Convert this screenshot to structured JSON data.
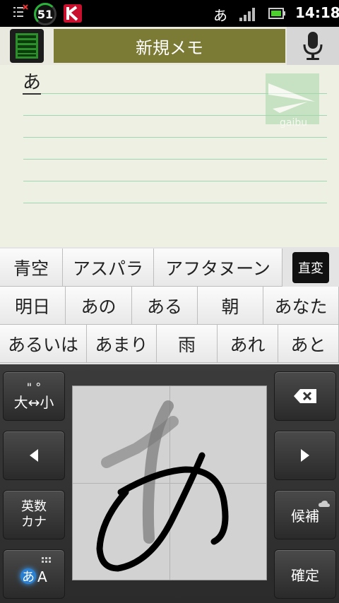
{
  "status_bar": {
    "badge_number": "51",
    "ime_indicator": "あ",
    "time": "14:18"
  },
  "header": {
    "title": "新規メモ"
  },
  "memo": {
    "text": "あ",
    "watermark_text": "gaibu"
  },
  "candidates": {
    "row1": [
      "青空",
      "アスパラ",
      "アフタヌーン"
    ],
    "convert_label": "直変",
    "row2": [
      "明日",
      "あの",
      "ある",
      "朝",
      "あなた"
    ],
    "row3": [
      "あるいは",
      "あまり",
      "雨",
      "あれ",
      "あと"
    ]
  },
  "keyboard": {
    "case_toggle_top": "\"  °",
    "case_toggle_bottom": "大↔小",
    "alnum_kana_line1": "英数",
    "alnum_kana_line2": "カナ",
    "mode_key_hira": "あ",
    "mode_key_alpha": "A",
    "candidates_key": "候補",
    "enter_key": "確定"
  }
}
